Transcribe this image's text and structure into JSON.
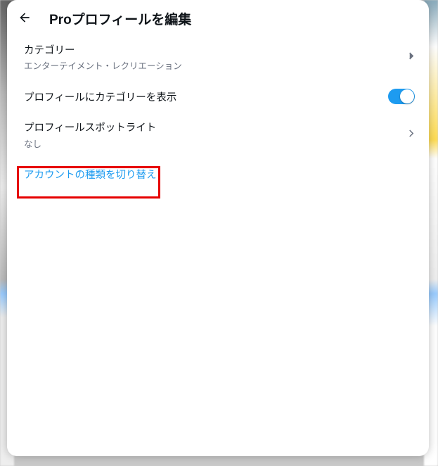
{
  "header": {
    "title": "Proプロフィールを編集"
  },
  "category": {
    "label": "カテゴリー",
    "value": "エンターテイメント・レクリエーション"
  },
  "showCategory": {
    "label": "プロフィールにカテゴリーを表示",
    "on": true
  },
  "spotlight": {
    "label": "プロフィールスポットライト",
    "value": "なし"
  },
  "switchAccount": {
    "label": "アカウントの種類を切り替え"
  }
}
